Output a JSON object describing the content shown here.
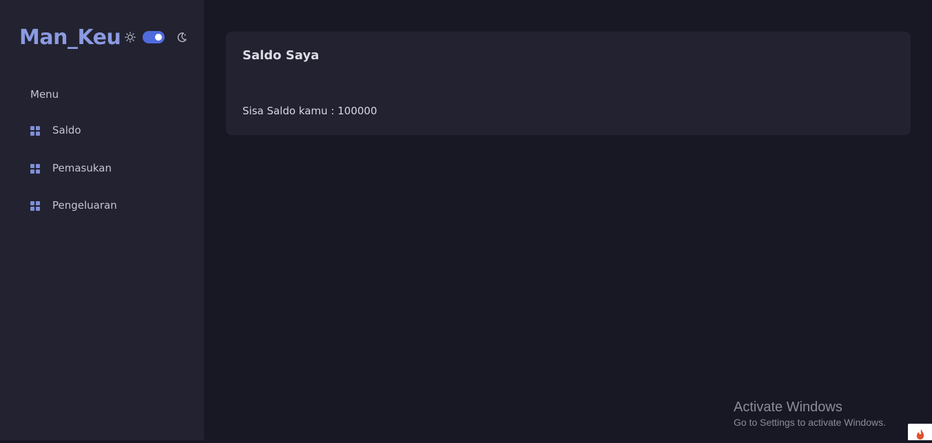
{
  "sidebar": {
    "brand": "Man_Keu",
    "theme_toggle": {
      "state": "dark",
      "sun_icon": "sun-icon",
      "moon_icon": "moon-icon",
      "accent": "#4f6bdc"
    },
    "menu_label": "Menu",
    "items": [
      {
        "label": "Saldo",
        "icon": "grid-icon"
      },
      {
        "label": "Pemasukan",
        "icon": "grid-icon"
      },
      {
        "label": "Pengeluaran",
        "icon": "grid-icon"
      }
    ]
  },
  "main": {
    "card_title": "Saldo Saya",
    "balance_text": "Sisa Saldo kamu : 100000"
  },
  "watermark": {
    "line1": "Activate Windows",
    "line2": "Go to Settings to activate Windows."
  },
  "colors": {
    "background": "#181825",
    "sidebar": "#222230",
    "brand": "#8b9ae0",
    "icon": "#7f8fd8"
  }
}
